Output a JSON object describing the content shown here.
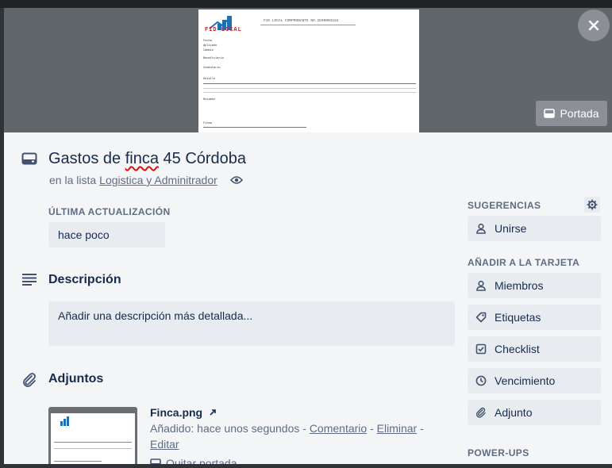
{
  "card": {
    "title_prefix": "Gastos de ",
    "title_misspelled": "finca",
    "title_suffix": " 45 Córdoba",
    "list_prefix": "en la lista",
    "list_name": "Logistica y Adminitrador"
  },
  "cover": {
    "button_label": "Portada",
    "document": {
      "logo_text": "FID LOCAL",
      "title": "FID LOCAL COMPROBANTE NO.2E00003184",
      "rows": [
        "Fecha",
        "Aplicado",
        "Cambio",
        "Beneficiario",
        "Comentario",
        "Detalle",
        "Resumen",
        "Firma"
      ]
    }
  },
  "updated": {
    "label": "ÚLTIMA ACTUALIZACIÓN",
    "value": "hace poco"
  },
  "description": {
    "title": "Descripción",
    "placeholder": "Añadir una descripción más detallada..."
  },
  "attachments": {
    "title": "Adjuntos",
    "file_name": "Finca.png",
    "added_prefix": "Añadido: hace unos segundos - ",
    "comment_link": "Comentario",
    "separator": " - ",
    "delete_link": "Eliminar",
    "edit_link": "Editar",
    "remove_cover_label": "Quitar portada"
  },
  "sidebar": {
    "suggestions_label": "SUGERENCIAS",
    "join_label": "Unirse",
    "add_label": "AÑADIR A LA TARJETA",
    "items": [
      {
        "label": "Miembros",
        "icon": "person-icon"
      },
      {
        "label": "Etiquetas",
        "icon": "tag-icon"
      },
      {
        "label": "Checklist",
        "icon": "checklist-icon"
      },
      {
        "label": "Vencimiento",
        "icon": "clock-icon"
      },
      {
        "label": "Adjunto",
        "icon": "paperclip-icon"
      }
    ],
    "powerups_label": "POWER-UPS"
  },
  "colors": {
    "modal_bg": "#f4f5f7",
    "button_bg": "#e8ebef",
    "text": "#172b4d",
    "muted": "#5e6c84",
    "overlay_button": "#8c9096"
  }
}
